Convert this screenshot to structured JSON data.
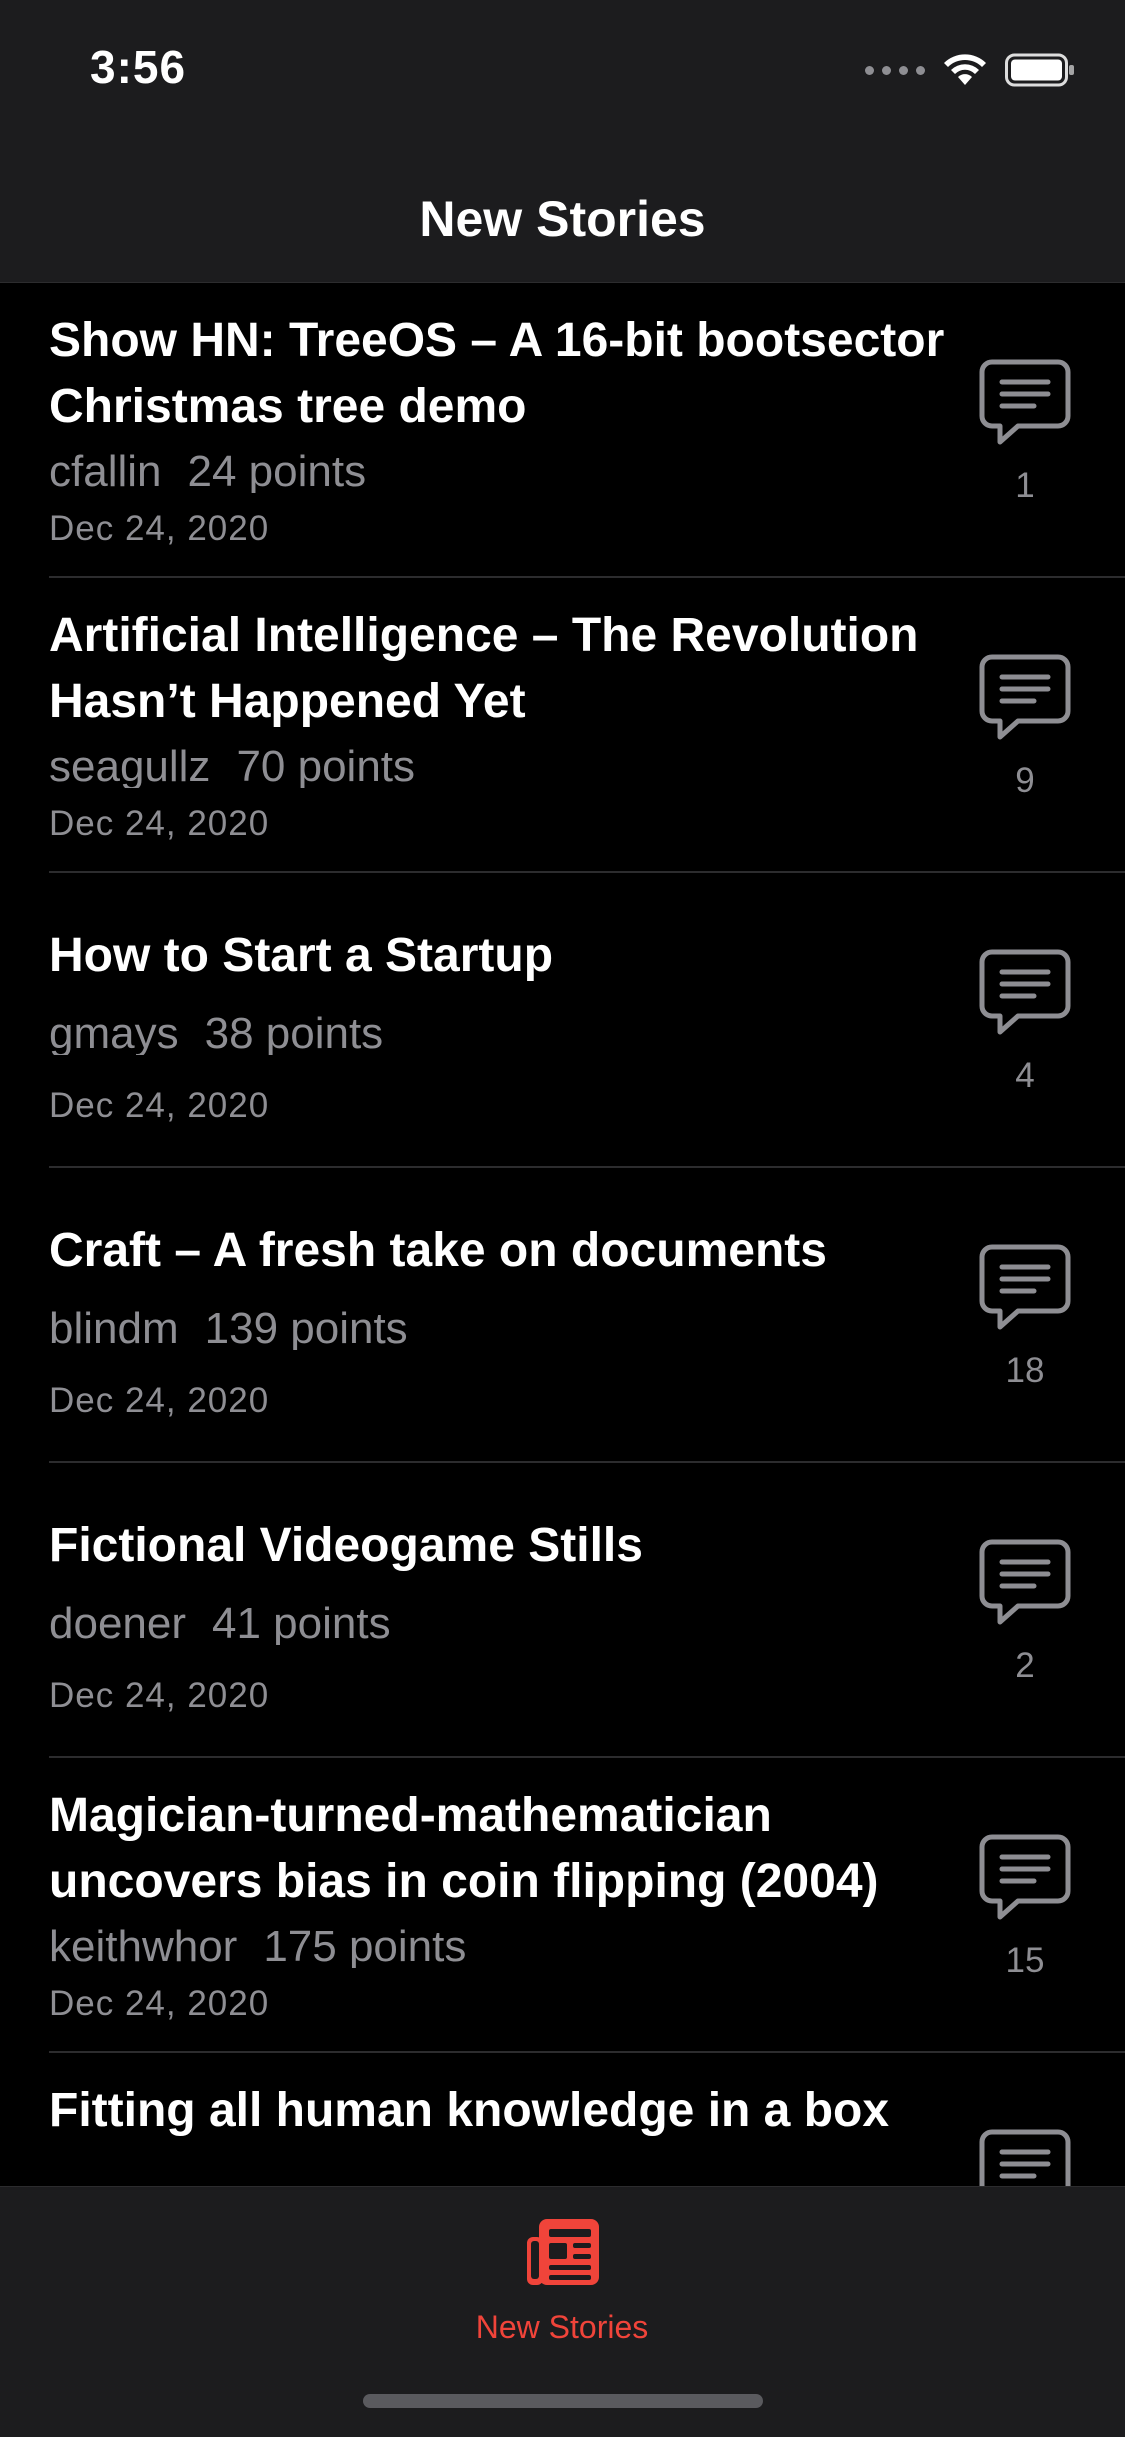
{
  "status_bar": {
    "time": "3:56"
  },
  "nav": {
    "title": "New Stories"
  },
  "stories": [
    {
      "title": "Show HN: TreeOS – A 16-bit bootsector Christmas tree demo",
      "user": "cfallin",
      "points": "24 points",
      "date": "Dec 24, 2020",
      "comments": "1"
    },
    {
      "title": "Artificial Intelligence – The Revolution Hasn’t Happened Yet",
      "user": "seagullz",
      "points": "70 points",
      "date": "Dec 24, 2020",
      "comments": "9"
    },
    {
      "title": "How to Start a Startup",
      "user": "gmays",
      "points": "38 points",
      "date": "Dec 24, 2020",
      "comments": "4"
    },
    {
      "title": "Craft – A fresh take on documents",
      "user": "blindm",
      "points": "139 points",
      "date": "Dec 24, 2020",
      "comments": "18"
    },
    {
      "title": "Fictional Videogame Stills",
      "user": "doener",
      "points": "41 points",
      "date": "Dec 24, 2020",
      "comments": "2"
    },
    {
      "title": "Magician-turned-mathematician uncovers bias in coin flipping (2004)",
      "user": "keithwhor",
      "points": "175 points",
      "date": "Dec 24, 2020",
      "comments": "15"
    },
    {
      "title": "Fitting all human knowledge in a box",
      "user": "",
      "points": "",
      "date": "",
      "comments": ""
    }
  ],
  "tab_bar": {
    "tab_label": "New Stories",
    "accent": "#f0443a"
  },
  "icons": {
    "comment": "speech-bubble-icon",
    "tab": "newspaper-icon"
  }
}
